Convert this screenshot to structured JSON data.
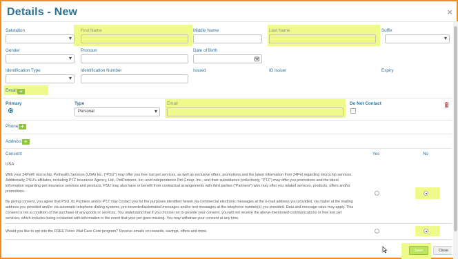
{
  "dialog": {
    "title": "Details - New",
    "close_symbol": "×"
  },
  "person": {
    "salutation": {
      "label": "Salutation",
      "value": ""
    },
    "first_name": {
      "label": "First Name",
      "value": ""
    },
    "middle_name": {
      "label": "Middle Name",
      "value": ""
    },
    "last_name": {
      "label": "Last Name",
      "value": ""
    },
    "suffix": {
      "label": "Suffix",
      "value": ""
    },
    "gender": {
      "label": "Gender",
      "value": ""
    },
    "pronoun": {
      "label": "Pronoun",
      "value": ""
    },
    "dob": {
      "label": "Date of Birth",
      "value": ""
    },
    "id_type": {
      "label": "Identification Type",
      "value": ""
    },
    "id_number": {
      "label": "Identification Number",
      "value": ""
    },
    "issued": {
      "label": "Issued"
    },
    "id_issuer": {
      "label": "ID Issuer"
    },
    "expiry": {
      "label": "Expiry"
    }
  },
  "email_section": {
    "label": "Email",
    "add_symbol": "+",
    "col_primary": "Primary",
    "col_type": "Type",
    "col_email": "Email",
    "col_dnc": "Do Not Contact",
    "type_value": "Personal",
    "email_value": ""
  },
  "phone_section": {
    "label": "Phone",
    "add_symbol": "+"
  },
  "address_section": {
    "label": "Address",
    "add_symbol": "+"
  },
  "consent": {
    "header": "Consent",
    "yes": "Yes",
    "no": "No",
    "region": "USA",
    "para1": "With your 24Pet® microchip, Pethealth Services (USA) Inc. (\"PSU\") may offer you free lost pet services, as well as exclusive offers, promotions and the latest information from 24Pet regarding microchip services. Additionally, PSU's affiliates, including PTZ Insurance Agency, Ltd., PetPartners, Inc. and Independence Pet Group, Inc., and their subsidiaries (collectively, \"PTZ\") may offer you promotions and the latest information regarding pet insurance services and products. PSU may also have or benefit from contractual arrangements with third parties (\"Partners\") who may offer you related services, products, offers and/or promotions.",
    "para2": "By giving consent, you agree that PSU, its Partners and/or PTZ may contact you for the purposes identified herein via commercial electronic messages at the e-mail address you provided, via mailer at the mailing address you provided and/or via automatic telephone dialing systems, pre-recorded/automated messages and/or text messages at the telephone number(s) you provided. Data and message rates may apply. This consent is not a condition of the purchase of any goods or services. You understand that if you choose not to provide your consent, you will not receive the above-mentioned communications or free lost pet services, which includes being contacted with information in the event that your pet goes missing. You may withdraw your consent at any time.",
    "q2": "Would you like to opt into the FREE Petco Vital Care Core program? Receive emails on rewards, savings, offers and more."
  },
  "footer": {
    "save": "Save",
    "close": "Close"
  },
  "colors": {
    "accent": "#2b6f95",
    "highlight": "#eefb8a",
    "frame": "#f08a24",
    "add_button": "#8cc63f",
    "delete_icon": "#e05050"
  },
  "icons": [
    "close-icon",
    "chevron-down-icon",
    "calendar-icon",
    "plus-icon",
    "trash-icon",
    "mouse-cursor-icon"
  ]
}
